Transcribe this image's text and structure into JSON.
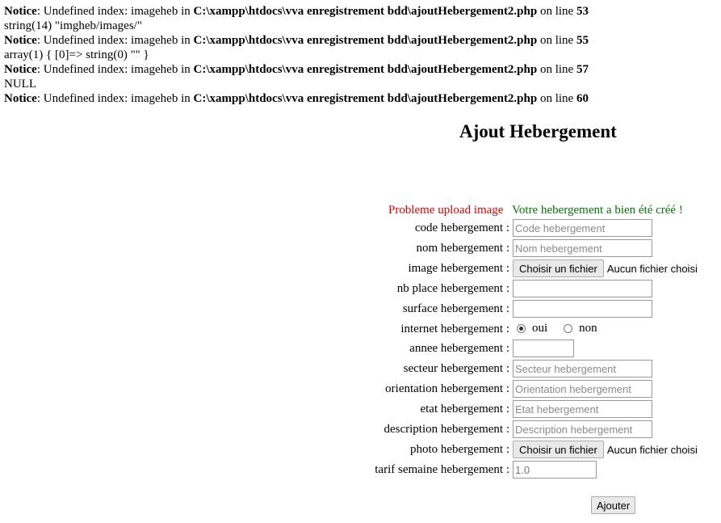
{
  "notices": [
    {
      "kind": "notice",
      "prefix": "Notice",
      "msg": ": Undefined index: imageheb in ",
      "path": "C:\\xampp\\htdocs\\vva enregistrement bdd\\ajoutHebergement2.php",
      "on_line": " on line ",
      "line": "53"
    },
    {
      "kind": "dump",
      "text": "string(14) \"imgheb/images/\""
    },
    {
      "kind": "notice",
      "prefix": "Notice",
      "msg": ": Undefined index: imageheb in ",
      "path": "C:\\xampp\\htdocs\\vva enregistrement bdd\\ajoutHebergement2.php",
      "on_line": " on line ",
      "line": "55"
    },
    {
      "kind": "dump",
      "text": "array(1) { [0]=> string(0) \"\" }"
    },
    {
      "kind": "notice",
      "prefix": "Notice",
      "msg": ": Undefined index: imageheb in ",
      "path": "C:\\xampp\\htdocs\\vva enregistrement bdd\\ajoutHebergement2.php",
      "on_line": " on line ",
      "line": "57"
    },
    {
      "kind": "dump",
      "text": "NULL"
    },
    {
      "kind": "notice",
      "prefix": "Notice",
      "msg": ": Undefined index: imageheb in ",
      "path": "C:\\xampp\\htdocs\\vva enregistrement bdd\\ajoutHebergement2.php",
      "on_line": " on line ",
      "line": "60"
    }
  ],
  "page_title": "Ajout Hebergement",
  "status": {
    "error": "Probleme upload image",
    "success": "Votre hebergement a bien été créé !",
    "error_color": "#e00000",
    "success_color": "#007700"
  },
  "form": {
    "code": {
      "label": "code hebergement :",
      "placeholder": "Code hebergement"
    },
    "nom": {
      "label": "nom hebergement :",
      "placeholder": "Nom hebergement"
    },
    "image": {
      "label": "image hebergement :",
      "button": "Choisir un fichier",
      "file": "Aucun fichier choisi"
    },
    "nbplace": {
      "label": "nb place hebergement :"
    },
    "surface": {
      "label": "surface hebergement :"
    },
    "internet": {
      "label": "internet hebergement :",
      "oui": "oui",
      "non": "non",
      "selected": "oui"
    },
    "annee": {
      "label": "annee hebergement :"
    },
    "secteur": {
      "label": "secteur hebergement :",
      "placeholder": "Secteur hebergement"
    },
    "orientation": {
      "label": "orientation hebergement :",
      "placeholder": "Orientation hebergement"
    },
    "etat": {
      "label": "etat hebergement :",
      "placeholder": "Etat hebergement"
    },
    "description": {
      "label": "description hebergement :",
      "placeholder": "Description hebergement"
    },
    "photo": {
      "label": "photo hebergement :",
      "button": "Choisir un fichier",
      "file": "Aucun fichier choisi"
    },
    "tarif": {
      "label": "tarif semaine hebergement :",
      "value": "1.0"
    },
    "submit": "Ajouter"
  }
}
